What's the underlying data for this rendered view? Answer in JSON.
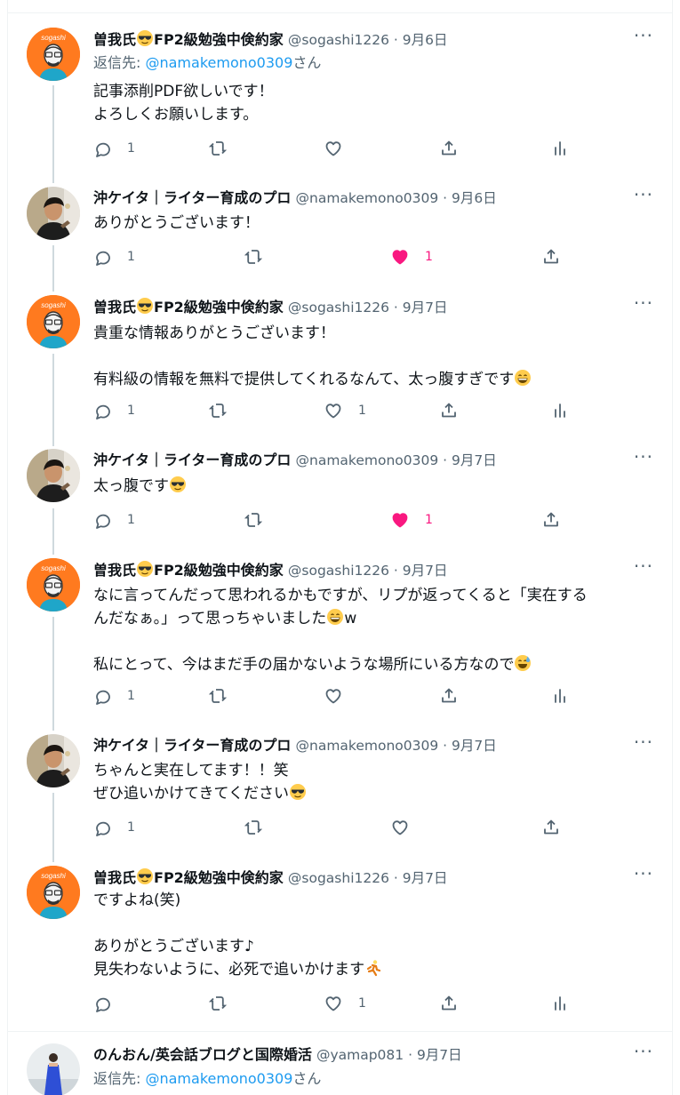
{
  "tweets": [
    {
      "author": "曽我氏😎FP2級勉強中倹約家",
      "handle": "@sogashi1226",
      "date": "9月6日",
      "avatar": "sogashi",
      "reply_label": "返信先: ",
      "reply_to": "@namakemono0309",
      "reply_suffix": "さん",
      "lines": [
        "記事添削PDF欲しいです！",
        "よろしくお願いします。"
      ],
      "reply_count": "1",
      "retweet_count": "",
      "like_count": "",
      "liked": false
    },
    {
      "author": "沖ケイタ｜ライター育成のプロ",
      "handle": "@namakemono0309",
      "date": "9月6日",
      "avatar": "oki",
      "lines": [
        "ありがとうございます！"
      ],
      "reply_count": "1",
      "retweet_count": "",
      "like_count": "1",
      "liked": true
    },
    {
      "author": "曽我氏😎FP2級勉強中倹約家",
      "handle": "@sogashi1226",
      "date": "9月7日",
      "avatar": "sogashi",
      "lines": [
        "貴重な情報ありがとうございます！",
        "",
        "有料級の情報を無料で提供してくれるなんて、太っ腹すぎです😄"
      ],
      "reply_count": "1",
      "retweet_count": "",
      "like_count": "1",
      "liked": false
    },
    {
      "author": "沖ケイタ｜ライター育成のプロ",
      "handle": "@namakemono0309",
      "date": "9月7日",
      "avatar": "oki",
      "lines": [
        "太っ腹です😎"
      ],
      "reply_count": "1",
      "retweet_count": "",
      "like_count": "1",
      "liked": true
    },
    {
      "author": "曽我氏😎FP2級勉強中倹約家",
      "handle": "@sogashi1226",
      "date": "9月7日",
      "avatar": "sogashi",
      "lines": [
        "なに言ってんだって思われるかもですが、リプが返ってくると「実在する",
        "んだなぁ。」って思っちゃいました😁w",
        "",
        "私にとって、今はまだ手の届かないような場所にいる方なので😅"
      ],
      "reply_count": "1",
      "retweet_count": "",
      "like_count": "",
      "liked": false
    },
    {
      "author": "沖ケイタ｜ライター育成のプロ",
      "handle": "@namakemono0309",
      "date": "9月7日",
      "avatar": "oki",
      "lines": [
        "ちゃんと実在してます！！笑",
        "ぜひ追いかけてきてください😎"
      ],
      "reply_count": "1",
      "retweet_count": "",
      "like_count": "",
      "liked": false
    },
    {
      "author": "曽我氏😎FP2級勉強中倹約家",
      "handle": "@sogashi1226",
      "date": "9月7日",
      "avatar": "sogashi",
      "lines": [
        "ですよね(笑)",
        "",
        "ありがとうございます♪",
        "見失わないように、必死で追いかけます🏃"
      ],
      "reply_count": "",
      "retweet_count": "",
      "like_count": "1",
      "liked": false
    },
    {
      "author": "のんおん/英会話ブログと国際婚活",
      "handle": "@yamap081",
      "date": "9月7日",
      "avatar": "non",
      "reply_label": "返信先: ",
      "reply_to": "@namakemono0309",
      "reply_suffix": "さん",
      "lines": []
    }
  ],
  "ui": {
    "more_label": "···",
    "separator": " · ",
    "avatar_text": "sogashi",
    "accent_color": "#1d9bf0",
    "like_color": "#f91880",
    "icons": [
      "reply-icon",
      "retweet-icon",
      "heart-icon",
      "share-icon",
      "analytics-icon",
      "more-icon"
    ]
  }
}
